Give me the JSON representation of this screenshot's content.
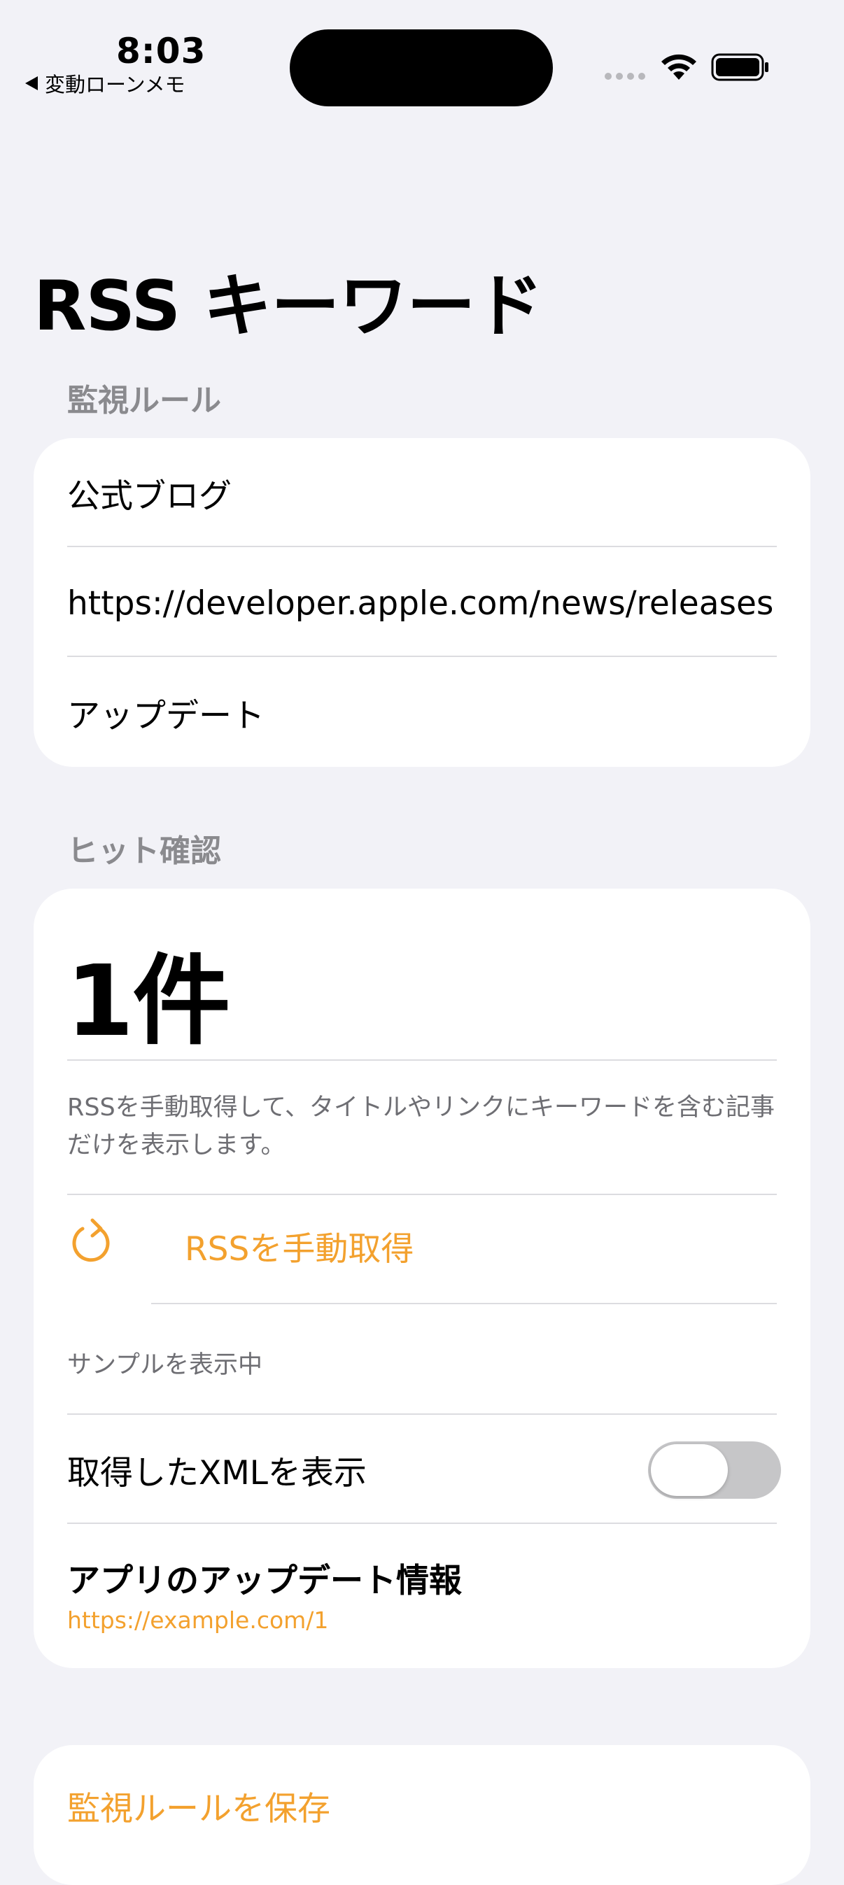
{
  "status_bar": {
    "time": "8:03",
    "back_label": "変動ローンメモ"
  },
  "page_title": "RSS キーワード",
  "rules_section": {
    "header": "監視ルール",
    "name": "公式ブログ",
    "url": "https://developer.apple.com/news/releases...",
    "keyword": "アップデート"
  },
  "hits_section": {
    "header": "ヒット確認",
    "count": "1件",
    "description": "RSSを手動取得して、タイトルやリンクにキーワードを含む記事だけを表示します。",
    "fetch_label": "RSSを手動取得",
    "status": "サンプルを表示中",
    "xml_toggle_label": "取得したXMLを表示",
    "xml_toggle_on": false,
    "article_title": "アプリのアップデート情報",
    "article_link": "https://example.com/1"
  },
  "save_label": "監視ルールを保存",
  "colors": {
    "accent": "#f3a12e",
    "background": "#f2f2f7",
    "secondary_text": "#8a8a8e"
  },
  "icons": {
    "fetch": "refresh-icon",
    "back": "back-arrow-icon"
  }
}
